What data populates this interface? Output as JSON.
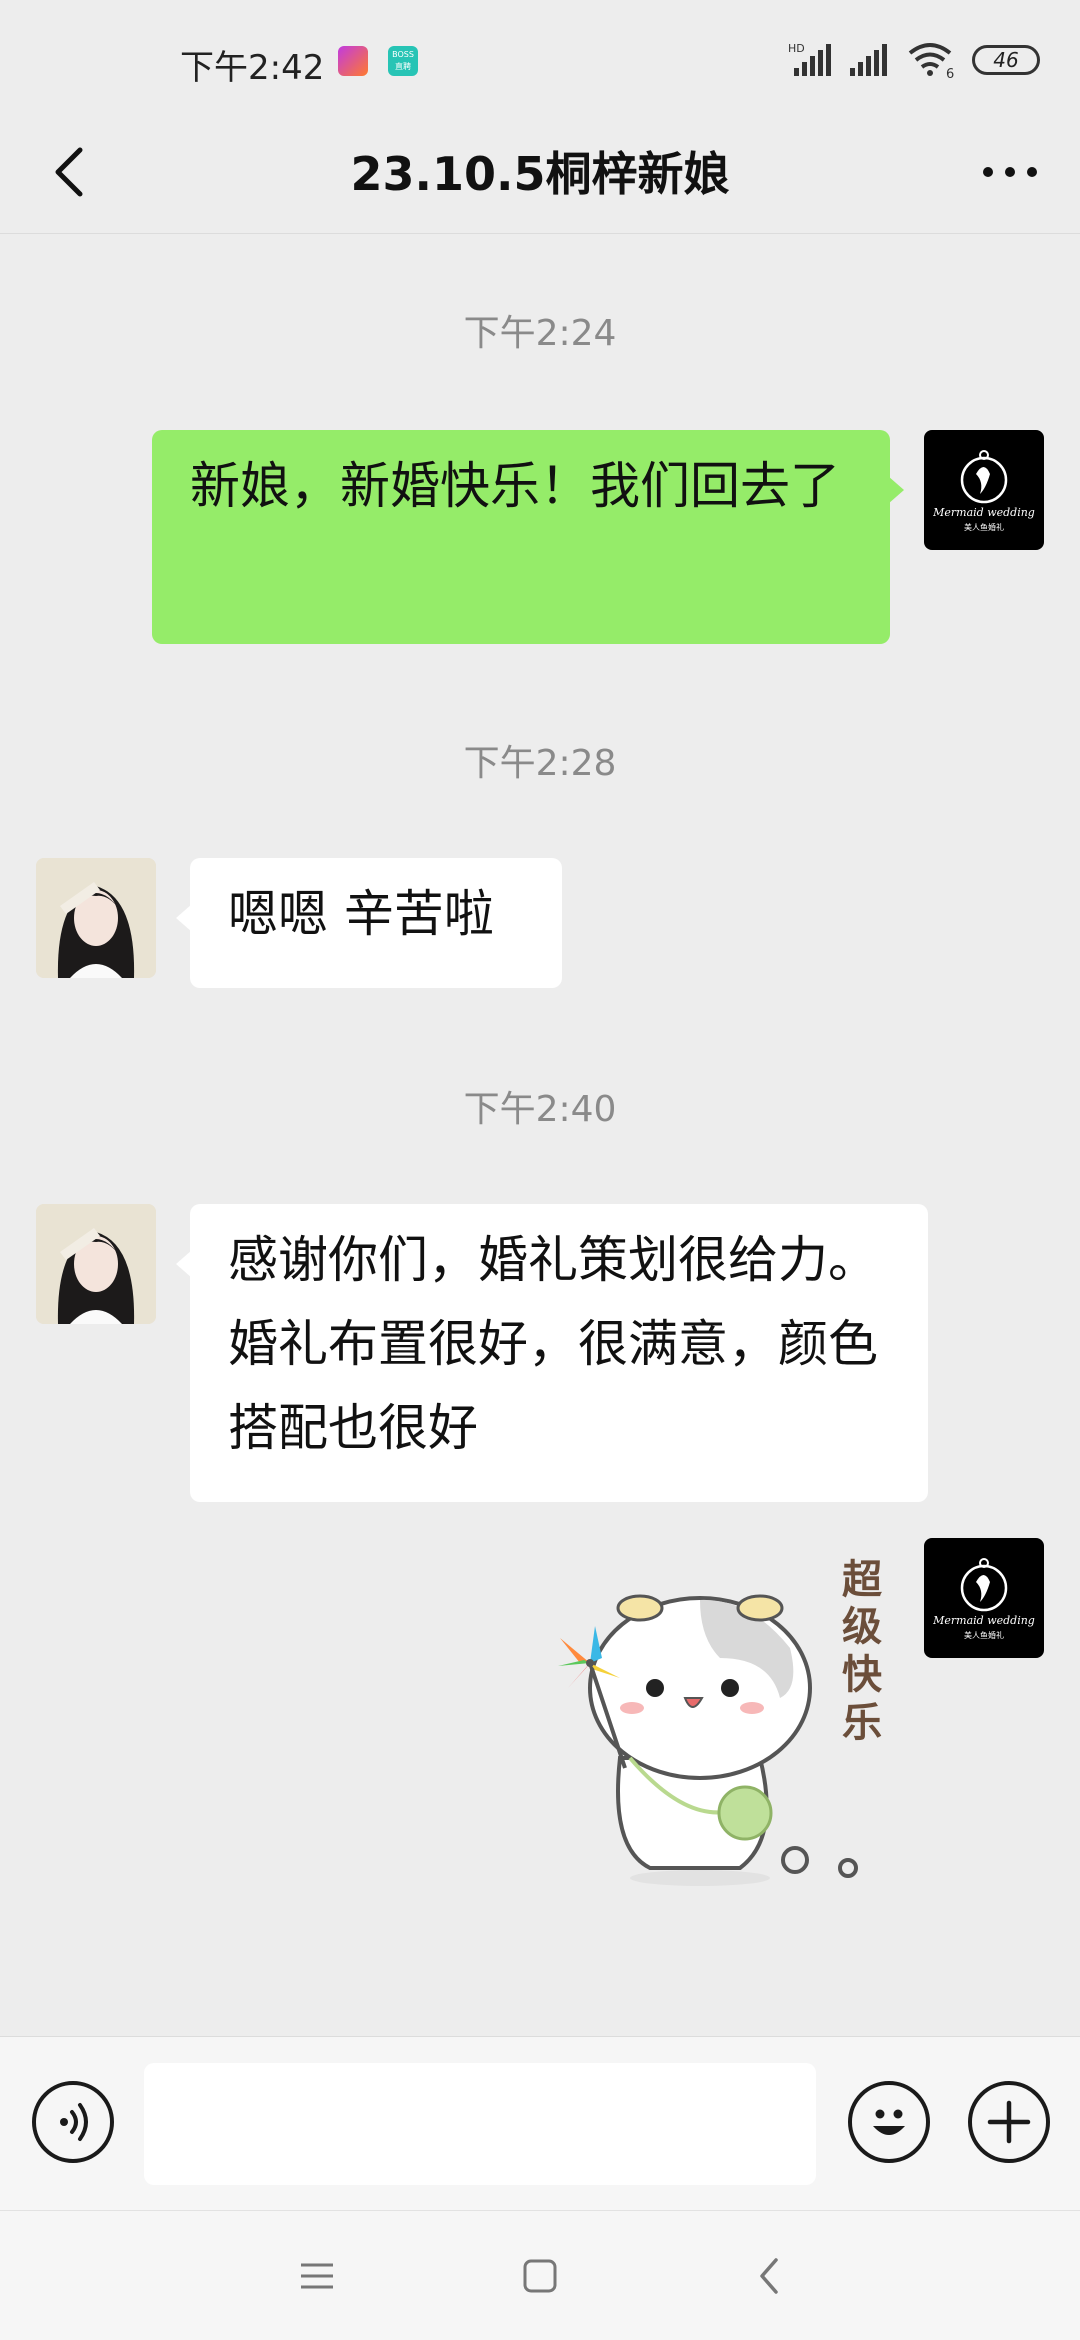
{
  "status_bar": {
    "time": "下午2:42",
    "app_icons": [
      "photo-app-icon",
      "boss-app-icon"
    ],
    "boss_icon_label": "BOSS\n直聘",
    "hd_label": "HD",
    "wifi_label": "6",
    "battery": "46"
  },
  "header": {
    "title": "23.10.5桐梓新娘"
  },
  "messages": [
    {
      "type": "timestamp",
      "text": "下午2:24"
    },
    {
      "type": "text",
      "direction": "out",
      "text": "新娘，新婚快乐！我们回去了"
    },
    {
      "type": "timestamp",
      "text": "下午2:28"
    },
    {
      "type": "text",
      "direction": "in",
      "text": "嗯嗯 辛苦啦"
    },
    {
      "type": "timestamp",
      "text": "下午2:40"
    },
    {
      "type": "text",
      "direction": "in",
      "text": "感谢你们，婚礼策划很给力。婚礼布置很好，很满意，颜色搭配也很好"
    },
    {
      "type": "sticker",
      "direction": "out",
      "text": "超级快乐"
    }
  ],
  "brand_avatar": {
    "logo_text": "Mermaid wedding",
    "sub_text": "美人鱼婚礼"
  },
  "input": {
    "value": "",
    "placeholder": ""
  },
  "colors": {
    "background": "#ededed",
    "bubble_out": "#95ec69",
    "bubble_in": "#ffffff",
    "timestamp": "#8a8a8a"
  }
}
